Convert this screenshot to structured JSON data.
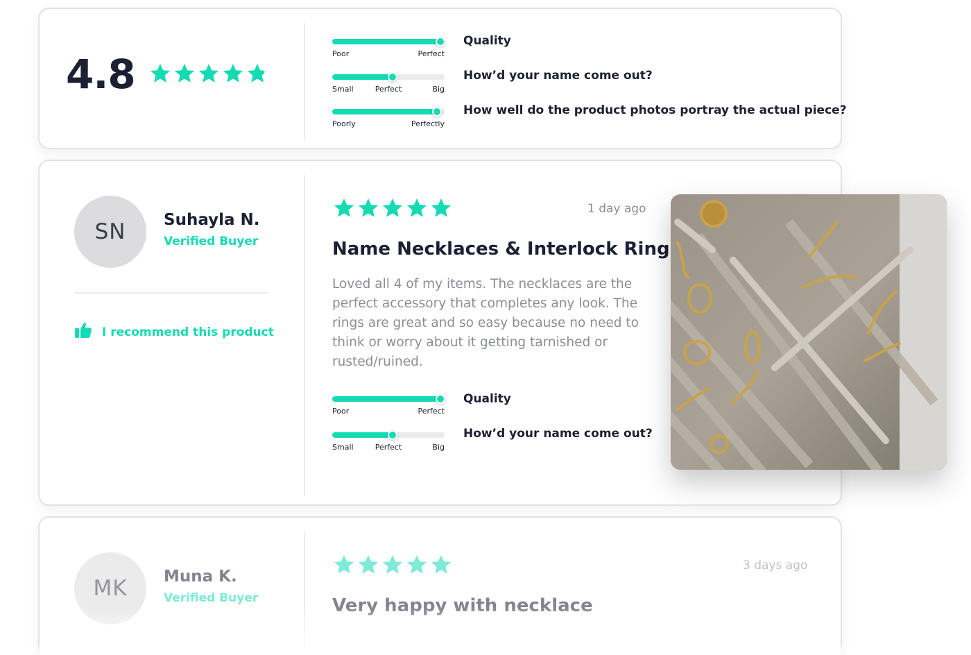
{
  "summary": {
    "rating": "4.8",
    "rating_value": 4.8,
    "sliders": [
      {
        "question": "Quality",
        "labels": [
          "Poor",
          "",
          "Perfect"
        ],
        "value": 0.96
      },
      {
        "question": "How’d your name come out?",
        "labels": [
          "Small",
          "Perfect",
          "Big"
        ],
        "value": 0.54
      },
      {
        "question": "How well do the product photos portray the actual piece?",
        "labels": [
          "Poorly",
          "",
          "Perfectly"
        ],
        "value": 0.93
      }
    ]
  },
  "reviews": [
    {
      "initials": "SN",
      "name": "Suhayla N.",
      "badge": "Verified Buyer",
      "recommend": "I recommend this product",
      "stars": 5,
      "time": "1 day ago",
      "title": "Name Necklaces & Interlock Rings",
      "body": "Loved all 4 of my items. The necklaces are the perfect accessory that completes any look. The rings are great and so easy because no need to think or worry about it getting tarnished or rusted/ruined.",
      "sliders": [
        {
          "question": "Quality",
          "labels": [
            "Poor",
            "",
            "Perfect"
          ],
          "value": 0.96
        },
        {
          "question": "How’d your name come out?",
          "labels": [
            "Small",
            "Perfect",
            "Big"
          ],
          "value": 0.54
        }
      ]
    },
    {
      "initials": "MK",
      "name": "Muna K.",
      "badge": "Verified Buyer",
      "stars": 5,
      "time": "3 days ago",
      "title": "Very happy with necklace"
    }
  ],
  "colors": {
    "accent": "#14dbb3",
    "text": "#1c2033",
    "muted": "#8a8d96",
    "border": "#e3e3e6"
  },
  "icons": {
    "star": "star-icon",
    "thumbs_up": "thumbs-up-icon"
  }
}
